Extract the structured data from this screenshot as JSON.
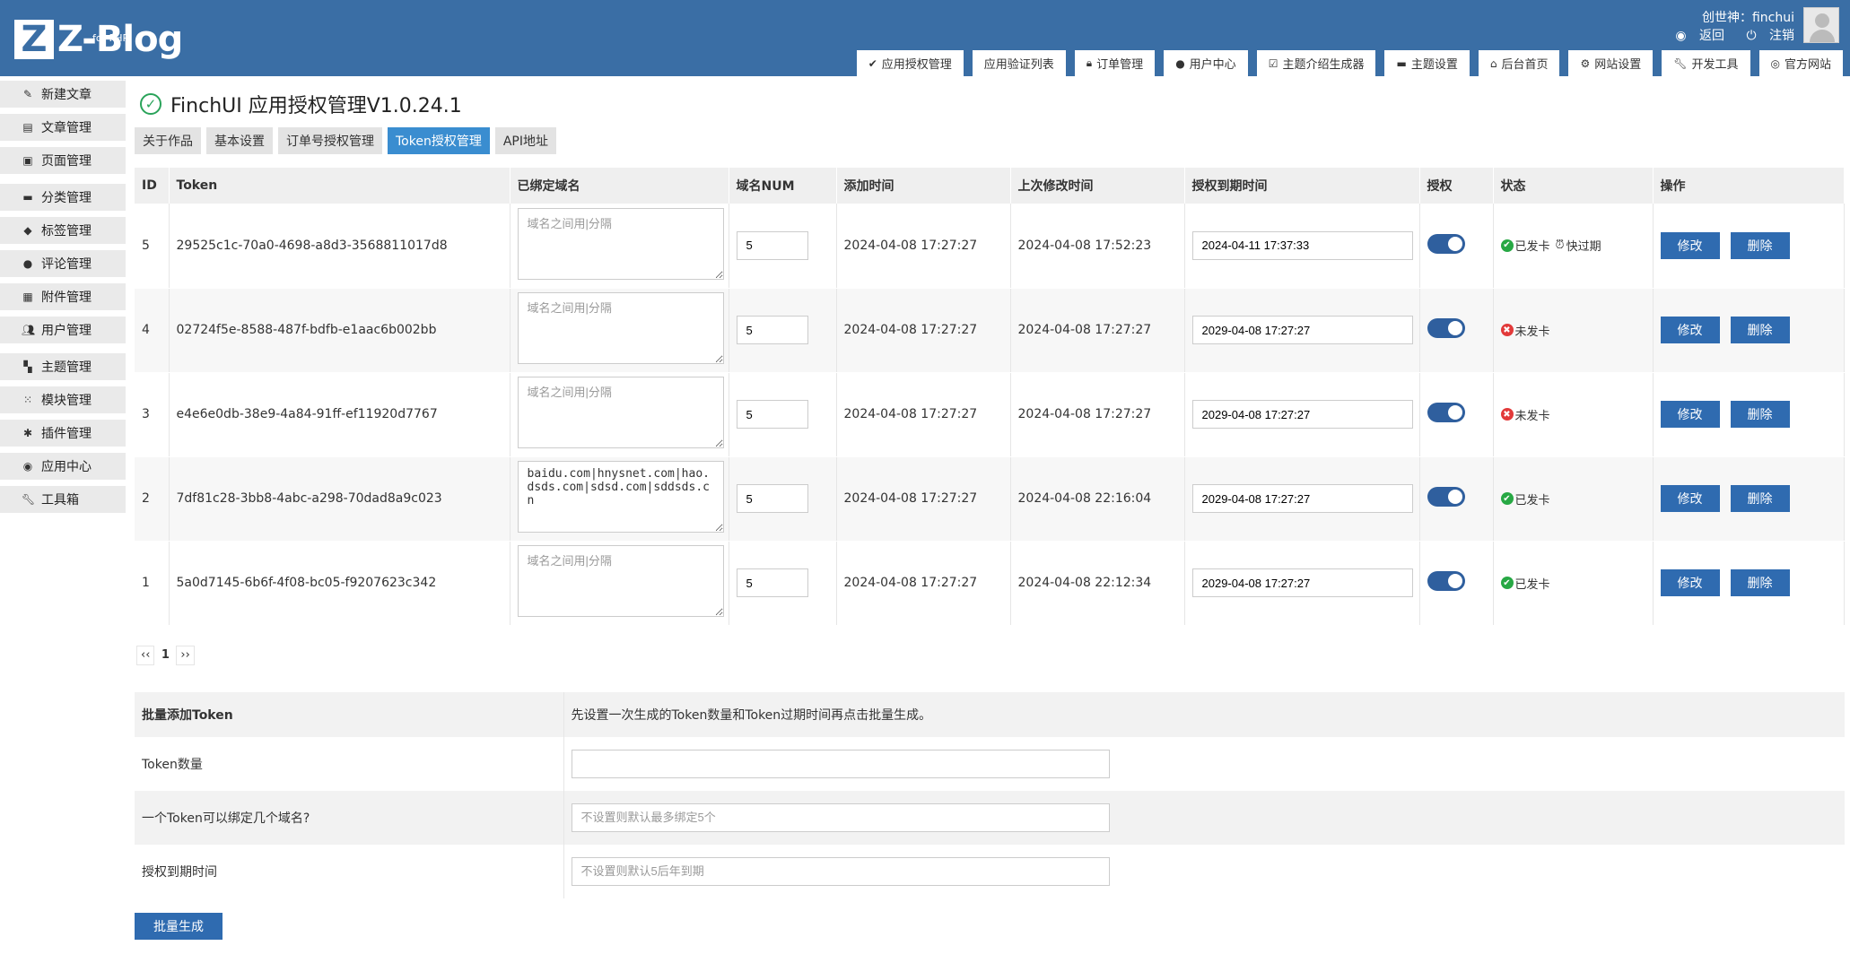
{
  "header": {
    "logo_text": "Z-Blog",
    "logo_sub": "for PHP",
    "user_line": "创世神：finchui",
    "back_label": "返回",
    "logout_label": "注销"
  },
  "topnav": [
    {
      "icon": "check-circle-icon",
      "label": "应用授权管理"
    },
    {
      "icon": "",
      "label": "应用验证列表"
    },
    {
      "icon": "lock-icon",
      "label": "订单管理"
    },
    {
      "icon": "user-icon",
      "label": "用户中心"
    },
    {
      "icon": "checkbox-icon",
      "label": "主题介绍生成器"
    },
    {
      "icon": "folder-icon",
      "label": "主题设置"
    },
    {
      "icon": "home-icon",
      "label": "后台首页"
    },
    {
      "icon": "gear-icon",
      "label": "网站设置"
    },
    {
      "icon": "wrench-icon",
      "label": "开发工具"
    },
    {
      "icon": "compass-icon",
      "label": "官方网站"
    }
  ],
  "sidebar": [
    {
      "icon": "edit-icon",
      "label": "新建文章"
    },
    {
      "icon": "article-icon",
      "label": "文章管理"
    },
    {
      "icon": "page-icon",
      "label": "页面管理"
    },
    {
      "icon": "folder-icon",
      "label": "分类管理"
    },
    {
      "icon": "tag-icon",
      "label": "标签管理"
    },
    {
      "icon": "comment-icon",
      "label": "评论管理"
    },
    {
      "icon": "attachment-icon",
      "label": "附件管理"
    },
    {
      "icon": "users-icon",
      "label": "用户管理"
    },
    {
      "icon": "theme-icon",
      "label": "主题管理"
    },
    {
      "icon": "module-icon",
      "label": "模块管理"
    },
    {
      "icon": "plugin-icon",
      "label": "插件管理"
    },
    {
      "icon": "app-center-icon",
      "label": "应用中心"
    },
    {
      "icon": "toolbox-icon",
      "label": "工具箱"
    }
  ],
  "page": {
    "title": "FinchUI 应用授权管理V1.0.24.1",
    "subtabs": [
      "关于作品",
      "基本设置",
      "订单号授权管理",
      "Token授权管理",
      "API地址"
    ],
    "active_subtab": "Token授权管理"
  },
  "table": {
    "headers": [
      "ID",
      "Token",
      "已绑定域名",
      "域名NUM",
      "添加时间",
      "上次修改时间",
      "授权到期时间",
      "授权",
      "状态",
      "操作"
    ],
    "domain_placeholder": "域名之间用|分隔",
    "edit_label": "修改",
    "delete_label": "删除",
    "rows": [
      {
        "id": "5",
        "token": "29525c1c-70a0-4698-a8d3-3568811017d8",
        "domains": "",
        "num": "5",
        "added": "2024-04-08 17:27:27",
        "modified": "2024-04-08 17:52:23",
        "expire": "2024-04-11 17:37:33",
        "status_ok": true,
        "status": "已发卡",
        "extra_status": "快过期"
      },
      {
        "id": "4",
        "token": "02724f5e-8588-487f-bdfb-e1aac6b002bb",
        "domains": "",
        "num": "5",
        "added": "2024-04-08 17:27:27",
        "modified": "2024-04-08 17:27:27",
        "expire": "2029-04-08 17:27:27",
        "status_ok": false,
        "status": "未发卡",
        "extra_status": ""
      },
      {
        "id": "3",
        "token": "e4e6e0db-38e9-4a84-91ff-ef11920d7767",
        "domains": "",
        "num": "5",
        "added": "2024-04-08 17:27:27",
        "modified": "2024-04-08 17:27:27",
        "expire": "2029-04-08 17:27:27",
        "status_ok": false,
        "status": "未发卡",
        "extra_status": ""
      },
      {
        "id": "2",
        "token": "7df81c28-3bb8-4abc-a298-70dad8a9c023",
        "domains": "baidu.com|hnysnet.com|hao.dsds.com|sdsd.com|sddsds.cn",
        "num": "5",
        "added": "2024-04-08 17:27:27",
        "modified": "2024-04-08 22:16:04",
        "expire": "2029-04-08 17:27:27",
        "status_ok": true,
        "status": "已发卡",
        "extra_status": ""
      },
      {
        "id": "1",
        "token": "5a0d7145-6b6f-4f08-bc05-f9207623c342",
        "domains": "",
        "num": "5",
        "added": "2024-04-08 17:27:27",
        "modified": "2024-04-08 22:12:34",
        "expire": "2029-04-08 17:27:27",
        "status_ok": true,
        "status": "已发卡",
        "extra_status": ""
      }
    ]
  },
  "pager": {
    "prev": "‹‹",
    "current": "1",
    "next": "››"
  },
  "batch": {
    "title": "批量添加Token",
    "desc": "先设置一次生成的Token数量和Token过期时间再点击批量生成。",
    "count_label": "Token数量",
    "count_value": "",
    "domains_label": "一个Token可以绑定几个域名?",
    "domains_placeholder": "不设置则默认最多绑定5个",
    "expire_label": "授权到期时间",
    "expire_placeholder": "不设置则默认5后年到期",
    "button": "批量生成"
  },
  "colors": {
    "header": "#3a6ea5",
    "accent": "#3a8dd0",
    "button": "#2f6bb0",
    "ok": "#27a844",
    "error": "#e23a3a"
  }
}
